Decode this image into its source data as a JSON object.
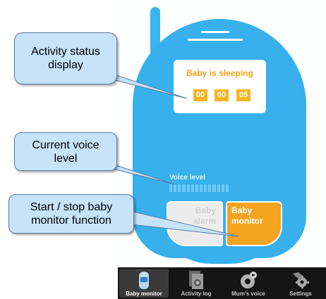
{
  "screen": {
    "status": "Baby is sleeping",
    "timer": [
      "00",
      "00",
      "05"
    ]
  },
  "voice": {
    "label": "Voice level",
    "level": 0
  },
  "buttons": {
    "alarm": [
      "Baby",
      "alarm"
    ],
    "monitor": [
      "Baby",
      "monitor"
    ]
  },
  "tabs": [
    {
      "label": "Baby monitor",
      "icon": "baby-monitor-icon",
      "active": true
    },
    {
      "label": "Activity log",
      "icon": "activity-log-icon",
      "active": false
    },
    {
      "label": "Mum's voice",
      "icon": "mums-voice-icon",
      "active": false
    },
    {
      "label": "Settings",
      "icon": "settings-icon",
      "active": false
    }
  ],
  "callouts": {
    "activity": [
      "Activity status",
      "display"
    ],
    "voice": [
      "Current voice",
      "level"
    ],
    "start_stop": [
      "Start / stop baby",
      "monitor function"
    ]
  },
  "colors": {
    "device_blue": "#37b0ec",
    "accent_orange": "#f5a41f",
    "callout_fill": "#c6e3fa",
    "tabbar": "#151515"
  }
}
